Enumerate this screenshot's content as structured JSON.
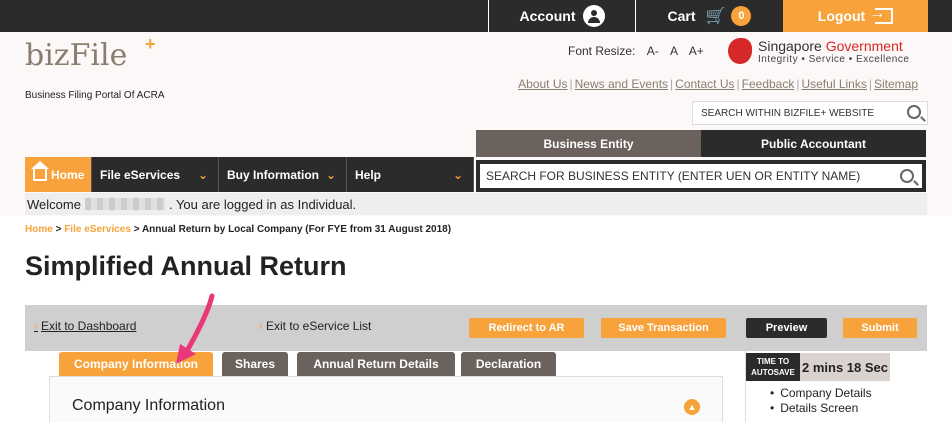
{
  "topbar": {
    "account_label": "Account",
    "cart_label": "Cart",
    "cart_count": "0",
    "logout_label": "Logout"
  },
  "header": {
    "logo_text": "bizFile",
    "logo_plus": "+",
    "tagline": "Business Filing Portal Of ACRA",
    "font_resize_label": "Font Resize:",
    "font_sizes": [
      "A-",
      "A",
      "A+"
    ],
    "gov_title": "Singapore",
    "gov_title2": "Government",
    "gov_subtitle": "Integrity • Service • Excellence",
    "links": [
      "About Us",
      "News and Events",
      "Contact Us",
      "Feedback",
      "Useful Links",
      "Sitemap"
    ],
    "site_search_placeholder": "SEARCH WITHIN BIZFILE+ WEBSITE"
  },
  "entity_tabs": [
    "Business Entity",
    "Public Accountant"
  ],
  "entity_search_placeholder": "SEARCH FOR BUSINESS ENTITY (ENTER UEN OR ENTITY NAME)",
  "nav": {
    "home": "Home",
    "file": "File eServices",
    "buy": "Buy Information",
    "help": "Help"
  },
  "welcome": {
    "prefix": "Welcome",
    "suffix": ". You are logged in as Individual."
  },
  "breadcrumb": {
    "home": "Home",
    "file": "File eServices",
    "current": "Annual Return by Local Company (For FYE from 31 August 2018)"
  },
  "page_title": "Simplified Annual Return",
  "actions": {
    "exit_dashboard": "Exit to Dashboard",
    "exit_list": "Exit to eService List",
    "redirect": "Redirect to AR",
    "save": "Save Transaction",
    "preview": "Preview",
    "submit": "Submit"
  },
  "tabs": [
    "Company Information",
    "Shares",
    "Annual Return Details",
    "Declaration"
  ],
  "section_title": "Company Information",
  "autosave": {
    "label": "TIME TO AUTOSAVE",
    "mins": "2 mins",
    "secs": "18 Sec"
  },
  "side_list": [
    "Company Details",
    "Details Screen"
  ],
  "colors": {
    "accent": "#f7a23b",
    "dark": "#2b2b2b",
    "brown": "#6b625e",
    "annotation": "#e8387a"
  }
}
